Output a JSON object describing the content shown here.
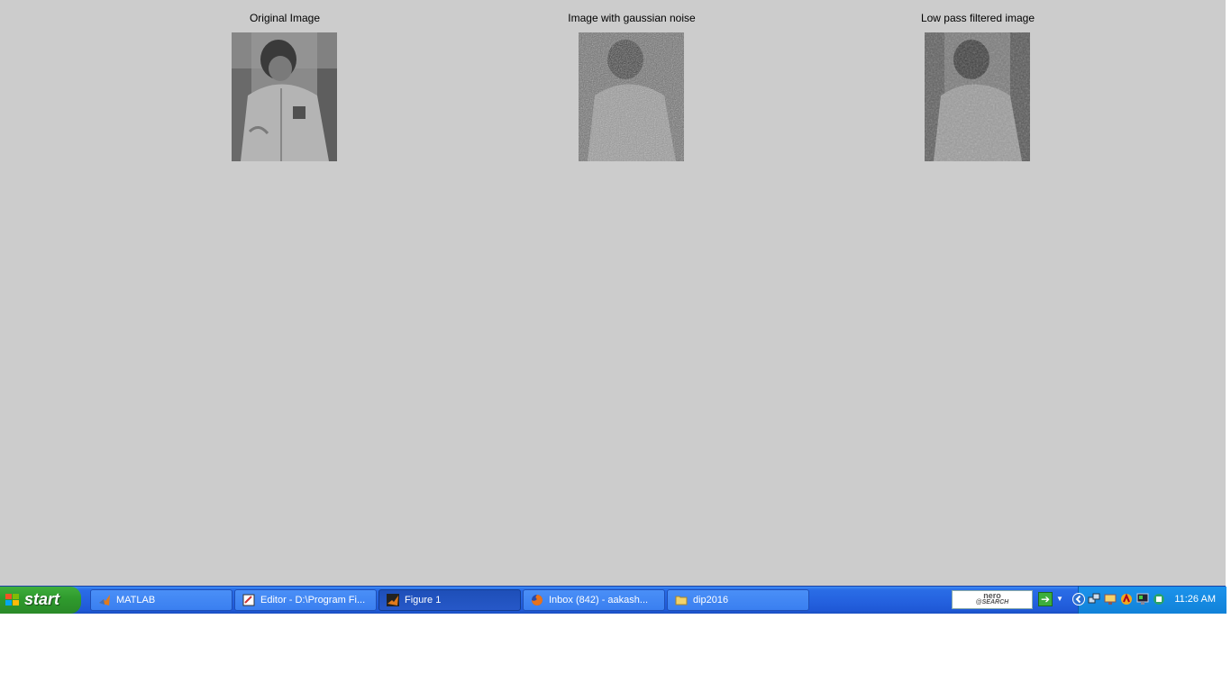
{
  "figure": {
    "panels": [
      {
        "title": "Original Image",
        "noise": "none"
      },
      {
        "title": "Image with gaussian noise",
        "noise": "gaussian"
      },
      {
        "title": "Low pass filtered image",
        "noise": "filtered"
      }
    ]
  },
  "taskbar": {
    "start_label": "start",
    "tasks": [
      {
        "label": "MATLAB",
        "icon": "matlab-icon"
      },
      {
        "label": "Editor - D:\\Program Fi...",
        "icon": "editor-icon"
      },
      {
        "label": "Figure 1",
        "icon": "matlab-figure-icon",
        "active": true
      },
      {
        "label": "Inbox (842) - aakash...",
        "icon": "firefox-icon"
      },
      {
        "label": "dip2016",
        "icon": "folder-icon"
      }
    ],
    "nero_line1": "nero",
    "nero_line2": "@SEARCH",
    "clock": "11:26 AM",
    "colors": {
      "taskbar": "#2563e0",
      "start": "#2f9a2d",
      "tray": "#1c93ec",
      "figure_bg": "#cccccc"
    }
  }
}
